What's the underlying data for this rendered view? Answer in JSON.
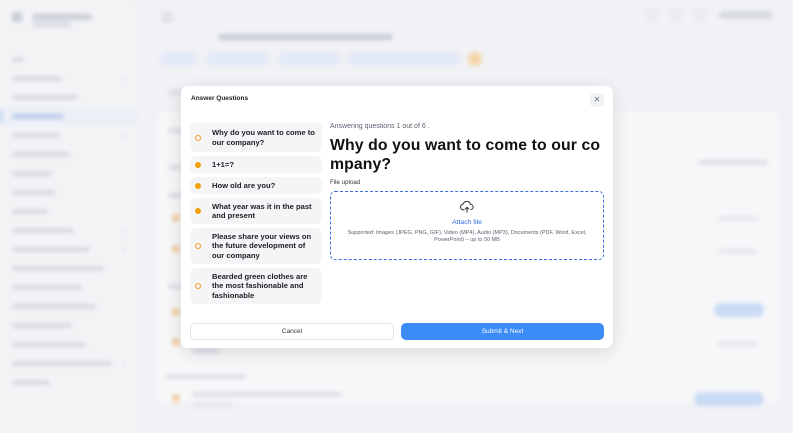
{
  "modal": {
    "title": "Answer Questions",
    "close_icon": "close-icon",
    "questions": [
      {
        "label": "Why do you want to come to our company?",
        "status": "current"
      },
      {
        "label": "1+1=?",
        "status": "pending"
      },
      {
        "label": "How old are you?",
        "status": "pending"
      },
      {
        "label": "What year was it in the past and present",
        "status": "pending"
      },
      {
        "label": "Please share your views on the future development of our company",
        "status": "current"
      },
      {
        "label": "Bearded green clothes are the most fashionable and fashionable",
        "status": "current"
      }
    ],
    "progress_text": "Answering questions 1 out of 6 .",
    "current_question": "Why do you want to come to our company?",
    "field_label": "File upload",
    "upload": {
      "icon": "cloud-upload-icon",
      "attach_label": "Attach file",
      "supported_text": "Supported: Images (JPEG, PNG, GIF), Video (MP4), Audio (MP3), Documents (PDF, Word, Excel, PowerPoint) – up to 50 MB"
    },
    "cancel_label": "Cancel",
    "submit_label": "Submit & Next"
  },
  "colors": {
    "accent": "#3b8cf6",
    "link": "#2f6be4",
    "status_dot": "#f59e0b",
    "dropzone_border": "#3b6fe0"
  }
}
